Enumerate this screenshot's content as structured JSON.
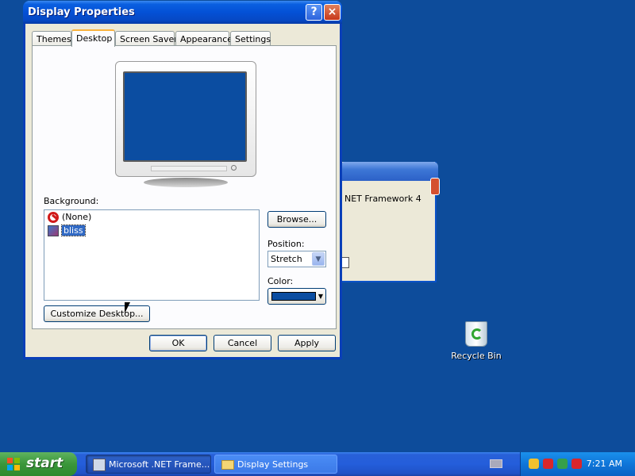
{
  "desktop": {
    "background_color": "#0d4c9b",
    "recycle_bin_label": "Recycle Bin"
  },
  "background_window": {
    "text": "NET Framework 4"
  },
  "dialog": {
    "title": "Display Properties",
    "help_glyph": "?",
    "close_glyph": "×",
    "tabs": [
      {
        "label": "Themes"
      },
      {
        "label": "Desktop"
      },
      {
        "label": "Screen Saver"
      },
      {
        "label": "Appearance"
      },
      {
        "label": "Settings"
      }
    ],
    "active_tab": "Desktop",
    "background_label": "Background:",
    "background_items": [
      {
        "label": "(None)",
        "icon": "no-symbol-icon"
      },
      {
        "label": "bliss",
        "icon": "image-file-icon",
        "selected": true
      }
    ],
    "browse_label": "Browse...",
    "position_label": "Position:",
    "position_value": "Stretch",
    "color_label": "Color:",
    "color_value": "#0b4da1",
    "customize_label": "Customize Desktop...",
    "ok_label": "OK",
    "cancel_label": "Cancel",
    "apply_label": "Apply"
  },
  "taskbar": {
    "start_label": "start",
    "tasks": [
      {
        "label": "Microsoft .NET Frame...",
        "icon": "installer-icon"
      },
      {
        "label": "Display Settings",
        "icon": "folder-icon"
      }
    ],
    "clock": "7:21 AM"
  }
}
